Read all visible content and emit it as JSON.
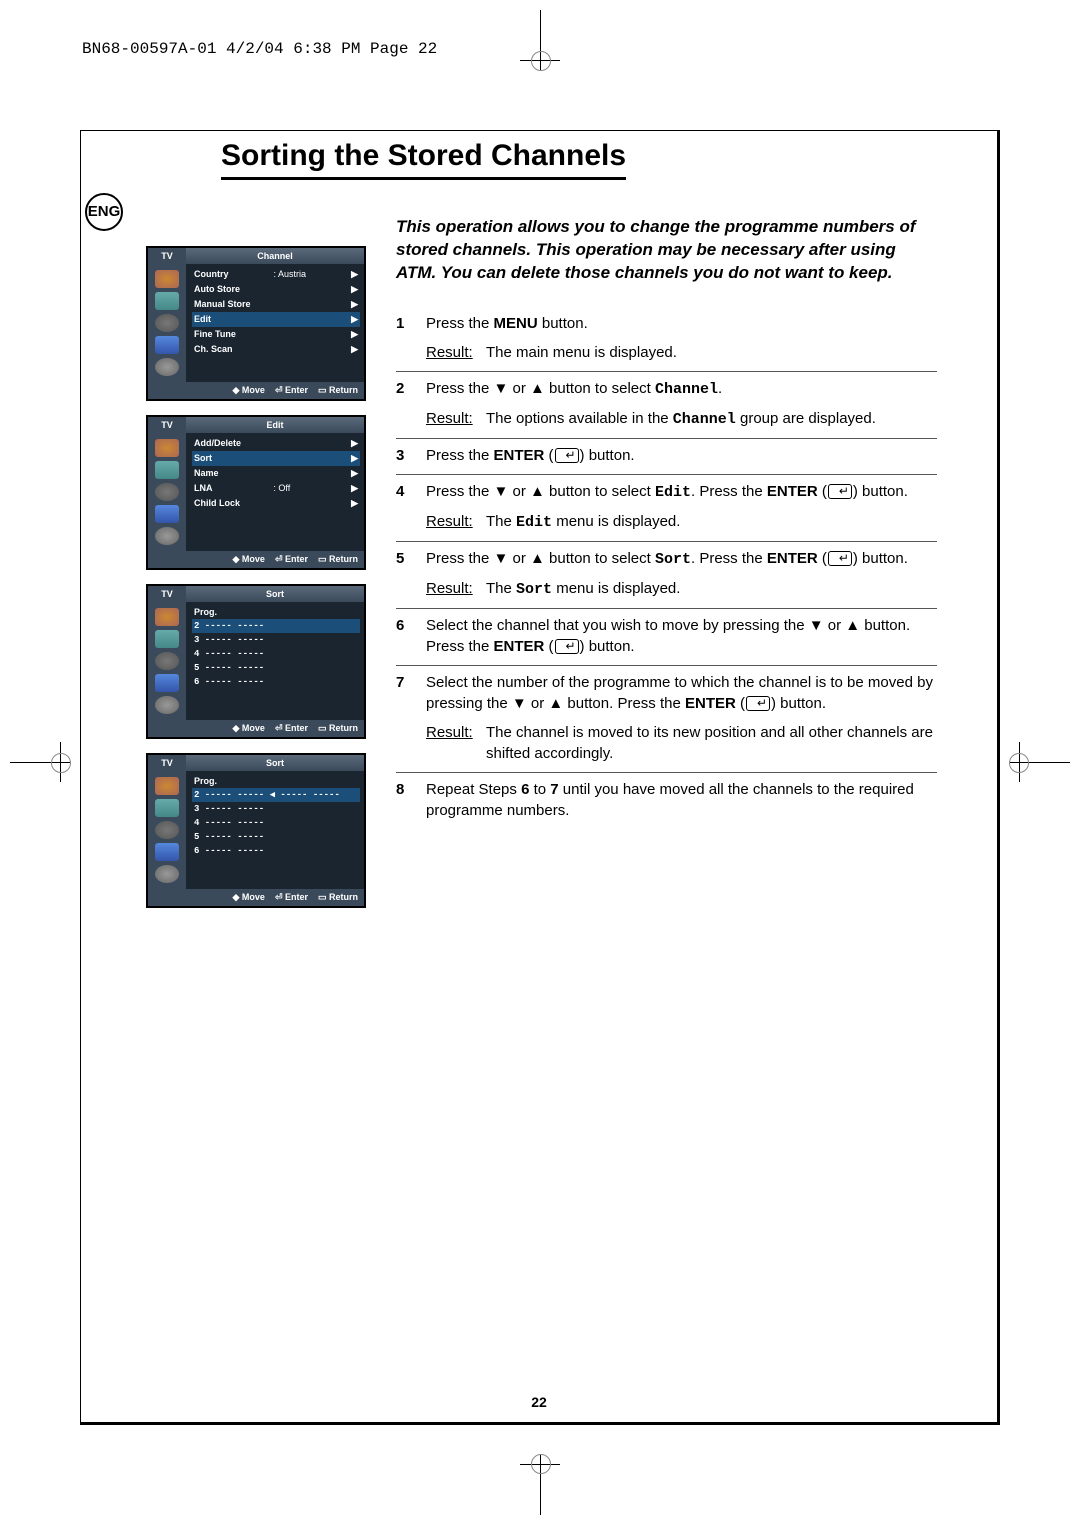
{
  "header_info": "BN68-00597A-01  4/2/04  6:38 PM  Page 22",
  "title": "Sorting the Stored Channels",
  "lang": "ENG",
  "intro": "This operation allows you to change the programme numbers of stored channels. This operation may be necessary after using ATM. You can delete those channels you do not want to keep.",
  "osd": {
    "screen1": {
      "tv": "TV",
      "title": "Channel",
      "rows": [
        [
          "Country",
          ": Austria",
          "▶"
        ],
        [
          "Auto Store",
          "",
          "▶"
        ],
        [
          "Manual Store",
          "",
          "▶"
        ],
        [
          "Edit",
          "",
          "▶"
        ],
        [
          "Fine Tune",
          "",
          "▶"
        ],
        [
          "Ch. Scan",
          "",
          "▶"
        ]
      ],
      "hi": 3,
      "foot": [
        "◆ Move",
        "⏎ Enter",
        "▭ Return"
      ]
    },
    "screen2": {
      "tv": "TV",
      "title": "Edit",
      "rows": [
        [
          "Add/Delete",
          "",
          "▶"
        ],
        [
          "Sort",
          "",
          "▶"
        ],
        [
          "Name",
          "",
          "▶"
        ],
        [
          "LNA",
          ": Off",
          "▶"
        ],
        [
          "Child Lock",
          "",
          "▶"
        ]
      ],
      "hi": 1,
      "foot": [
        "◆ Move",
        "⏎ Enter",
        "▭ Return"
      ]
    },
    "screen3": {
      "tv": "TV",
      "title": "Sort",
      "header": "Prog.",
      "progs": [
        "2  -----   -----",
        "3  -----   -----",
        "4  -----   -----",
        "5  -----   -----",
        "6  -----   -----"
      ],
      "hi": 0,
      "foot": [
        "◆ Move",
        "⏎ Enter",
        "▭ Return"
      ]
    },
    "screen4": {
      "tv": "TV",
      "title": "Sort",
      "header": "Prog.",
      "progs": [
        "2  -----   -----  ◀ -----   -----",
        "3  -----   -----",
        "4  -----   -----",
        "5  -----   -----",
        "6  -----   -----"
      ],
      "hi": 0,
      "foot": [
        "◆ Move",
        "⏎ Enter",
        "▭ Return"
      ]
    }
  },
  "steps": [
    {
      "n": "1",
      "t": "Press the <b>MENU</b> button.",
      "r": "The main menu is displayed."
    },
    {
      "n": "2",
      "t": "Press the ▼ or ▲ button to select <span class='tt'>Channel</span>.",
      "r": "The options available in the <span class='tt'>Channel</span> group are displayed."
    },
    {
      "n": "3",
      "t": "Press the <b>ENTER</b> (<span class='enter-i'></span>) button."
    },
    {
      "n": "4",
      "t": "Press the ▼ or ▲ button to select <span class='tt'>Edit</span>. Press the <b>ENTER</b> (<span class='enter-i'></span>) button.",
      "r": "The <span class='tt'>Edit</span> menu is displayed."
    },
    {
      "n": "5",
      "t": "Press the ▼ or ▲ button to select <span class='tt'>Sort</span>. Press the <b>ENTER</b> (<span class='enter-i'></span>) button.",
      "r": "The <span class='tt'>Sort</span> menu is displayed."
    },
    {
      "n": "6",
      "t": "Select the channel that you wish to move by pressing the ▼ or ▲ button. Press the <b>ENTER</b> (<span class='enter-i'></span>) button."
    },
    {
      "n": "7",
      "t": "Select the number of the programme to which the channel is to be moved by pressing the ▼ or ▲ button. Press the <b>ENTER</b> (<span class='enter-i'></span>) button.",
      "r": "The channel is moved to its new position and all other channels are shifted accordingly."
    },
    {
      "n": "8",
      "t": "Repeat Steps <b>6</b> to <b>7</b> until you have moved all the channels to the required programme numbers."
    }
  ],
  "result_label": "Result:",
  "page_num": "22"
}
